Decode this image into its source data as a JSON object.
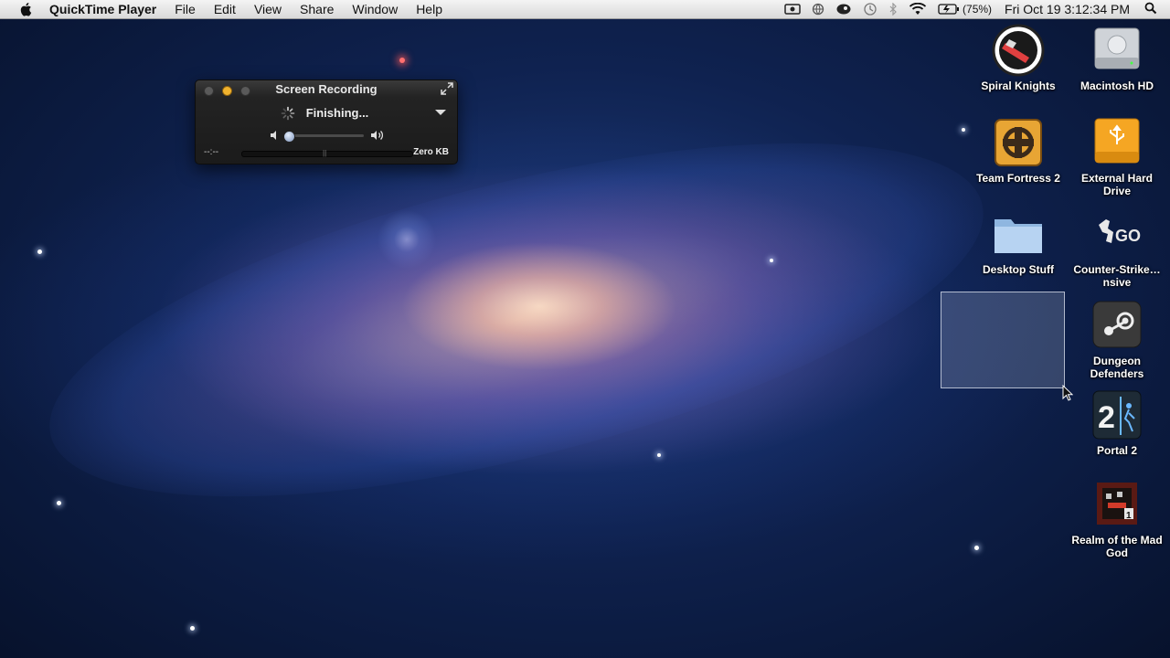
{
  "menubar": {
    "app_name": "QuickTime Player",
    "items": [
      "File",
      "Edit",
      "View",
      "Share",
      "Window",
      "Help"
    ],
    "battery_percent": "(75%)",
    "clock": "Fri Oct 19  3:12:34 PM"
  },
  "quicktime_window": {
    "title": "Screen Recording",
    "status": "Finishing...",
    "time": "--:--",
    "file_size": "Zero KB",
    "volume_level": 0.0
  },
  "desktop_icons": [
    {
      "label": "Spiral Knights",
      "icon": "spiral-knights-icon"
    },
    {
      "label": "Macintosh HD",
      "icon": "hard-drive-icon"
    },
    {
      "label": "Team Fortress 2",
      "icon": "team-fortress-icon"
    },
    {
      "label": "External Hard Drive",
      "icon": "usb-drive-icon"
    },
    {
      "label": "Desktop Stuff",
      "icon": "folder-icon"
    },
    {
      "label": "Counter-Strike…nsive",
      "icon": "counter-strike-icon"
    },
    {
      "label": "Dungeon Defenders",
      "icon": "steam-icon"
    },
    {
      "label": "Portal 2",
      "icon": "portal-icon"
    },
    {
      "label": "Realm of the Mad God",
      "icon": "realm-icon"
    }
  ],
  "colors": {
    "menubar_bg": "#e6e6e6",
    "hud_bg": "#1e1e1e",
    "traffic_yellow": "#f0b22e"
  }
}
